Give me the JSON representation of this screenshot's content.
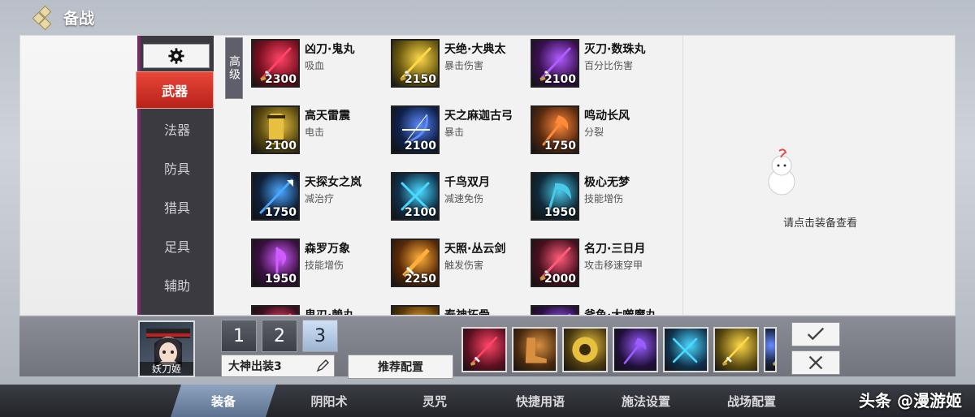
{
  "header": {
    "title": "备战"
  },
  "categories": [
    {
      "label": "武器",
      "active": true
    },
    {
      "label": "法器",
      "active": false
    },
    {
      "label": "防具",
      "active": false
    },
    {
      "label": "猎具",
      "active": false
    },
    {
      "label": "足具",
      "active": false
    },
    {
      "label": "辅助",
      "active": false
    }
  ],
  "tier_tag": "高级",
  "items": [
    {
      "name": "凶刀·鬼丸",
      "desc": "吸血",
      "price": "2300",
      "bg": "#7a1020",
      "glow": "#ff4466",
      "icon": "katana-icon"
    },
    {
      "name": "天绝·大典太",
      "desc": "暴击伤害",
      "price": "2150",
      "bg": "#6a5a10",
      "glow": "#ffd84a",
      "icon": "katana-icon"
    },
    {
      "name": "灭刀·数珠丸",
      "desc": "百分比伤害",
      "price": "2100",
      "bg": "#3a1050",
      "glow": "#b05cff",
      "icon": "katana-icon"
    },
    {
      "name": "高天雷震",
      "desc": "电击",
      "price": "2100",
      "bg": "#5a4a10",
      "glow": "#e8c040",
      "icon": "scroll-icon"
    },
    {
      "name": "天之麻迦古弓",
      "desc": "暴击",
      "price": "2100",
      "bg": "#10204a",
      "glow": "#5c8cff",
      "icon": "bow-icon"
    },
    {
      "name": "鸣动长风",
      "desc": "分裂",
      "price": "1750",
      "bg": "#5a2a10",
      "glow": "#ff8a3a",
      "icon": "glaive-icon"
    },
    {
      "name": "天探女之岚",
      "desc": "减治疗",
      "price": "1750",
      "bg": "#10203a",
      "glow": "#4aa8ff",
      "icon": "spear-icon"
    },
    {
      "name": "千鸟双月",
      "desc": "减速免伤",
      "price": "2100",
      "bg": "#10304a",
      "glow": "#4ad8ff",
      "icon": "twin-blades-icon"
    },
    {
      "name": "极心无梦",
      "desc": "技能增伤",
      "price": "1950",
      "bg": "#102a3a",
      "glow": "#4ac8e8",
      "icon": "scythe-icon"
    },
    {
      "name": "森罗万象",
      "desc": "技能增伤",
      "price": "1950",
      "bg": "#3a1040",
      "glow": "#d05cff",
      "icon": "axe-icon"
    },
    {
      "name": "天照·丛云剑",
      "desc": "触发伤害",
      "price": "2250",
      "bg": "#5a2a08",
      "glow": "#ffb03a",
      "icon": "sword-icon"
    },
    {
      "name": "名刀·三日月",
      "desc": "攻击移速穿甲",
      "price": "2000",
      "bg": "#4a1020",
      "glow": "#ff5c7a",
      "icon": "katana-icon"
    },
    {
      "name": "鬼刃·赖丸",
      "desc": "",
      "price": "",
      "bg": "#3a1020",
      "glow": "#ff4466",
      "icon": "katana-icon"
    },
    {
      "name": "泰神拓骨",
      "desc": "",
      "price": "",
      "bg": "#5a3a08",
      "glow": "#ffb03a",
      "icon": "sword-icon"
    },
    {
      "name": "斧鱼·大噬魔丸",
      "desc": "",
      "price": "",
      "bg": "#2a1040",
      "glow": "#a05cff",
      "icon": "katana-icon"
    }
  ],
  "detail": {
    "hint": "请点击装备查看"
  },
  "hero": {
    "name": "妖刀姬"
  },
  "loadout_slots": [
    {
      "label": "1",
      "active": false
    },
    {
      "label": "2",
      "active": false
    },
    {
      "label": "3",
      "active": true
    }
  ],
  "loadout": {
    "name": "大神出装3",
    "recommend_label": "推荐配置"
  },
  "equipped": [
    {
      "icon": "katana-icon",
      "bg": "#5a1020",
      "glow": "#ff4466"
    },
    {
      "icon": "boots-icon",
      "bg": "#4a2a10",
      "glow": "#d89040"
    },
    {
      "icon": "shield-icon",
      "bg": "#4a3a10",
      "glow": "#e8c040"
    },
    {
      "icon": "glaive-icon",
      "bg": "#20103a",
      "glow": "#9a5cff"
    },
    {
      "icon": "twin-blades-icon",
      "bg": "#10304a",
      "glow": "#4ad8ff"
    },
    {
      "icon": "katana-icon",
      "bg": "#5a4a10",
      "glow": "#ffd84a"
    },
    {
      "icon": "katana-icon",
      "bg": "#1a2a4a",
      "glow": "#6a8cff"
    }
  ],
  "nav": [
    {
      "label": "装备",
      "active": true
    },
    {
      "label": "阴阳术",
      "active": false
    },
    {
      "label": "灵咒",
      "active": false
    },
    {
      "label": "快捷用语",
      "active": false
    },
    {
      "label": "施法设置",
      "active": false
    },
    {
      "label": "战场配置",
      "active": false
    }
  ],
  "watermark": "头条 @漫游姬"
}
